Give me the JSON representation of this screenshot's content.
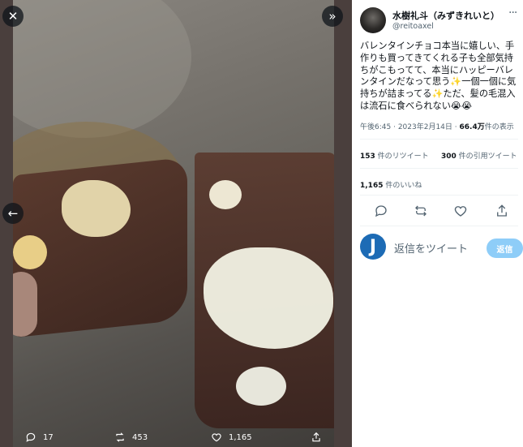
{
  "tweet": {
    "display_name": "水樹礼斗（みずきれいと）",
    "handle": "@reitoaxel",
    "text": "バレンタインチョコ本当に嬉しい、手作りも買ってきてくれる子も全部気持ちがこもってて、本当にハッピーバレンタインだなって思う✨一個一個に気持ちが詰まってる✨ただ、髪の毛混入は流石に食べられない😭😭",
    "time": "午後6:45",
    "date": "2023年2月14日",
    "views_count": "66.4万",
    "views_label": "件の表示",
    "retweets_count": "153",
    "retweets_label": "件のリツイート",
    "quotes_count": "300",
    "quotes_label": "件の引用ツイート",
    "likes_count": "1,165",
    "likes_label": "件のいいね"
  },
  "media_bar": {
    "reply_count": "17",
    "retweet_count": "453",
    "like_count": "1,165"
  },
  "reply": {
    "avatar_letter": "J",
    "placeholder": "返信をツイート",
    "button": "返信"
  },
  "icons": {
    "close": "close-icon",
    "collapse": "double-chevron-right-icon",
    "prev": "arrow-left-icon"
  },
  "colors": {
    "accent": "#1d9bf0",
    "reply_button_disabled": "#8ecdf8",
    "muted_text": "#536471"
  }
}
